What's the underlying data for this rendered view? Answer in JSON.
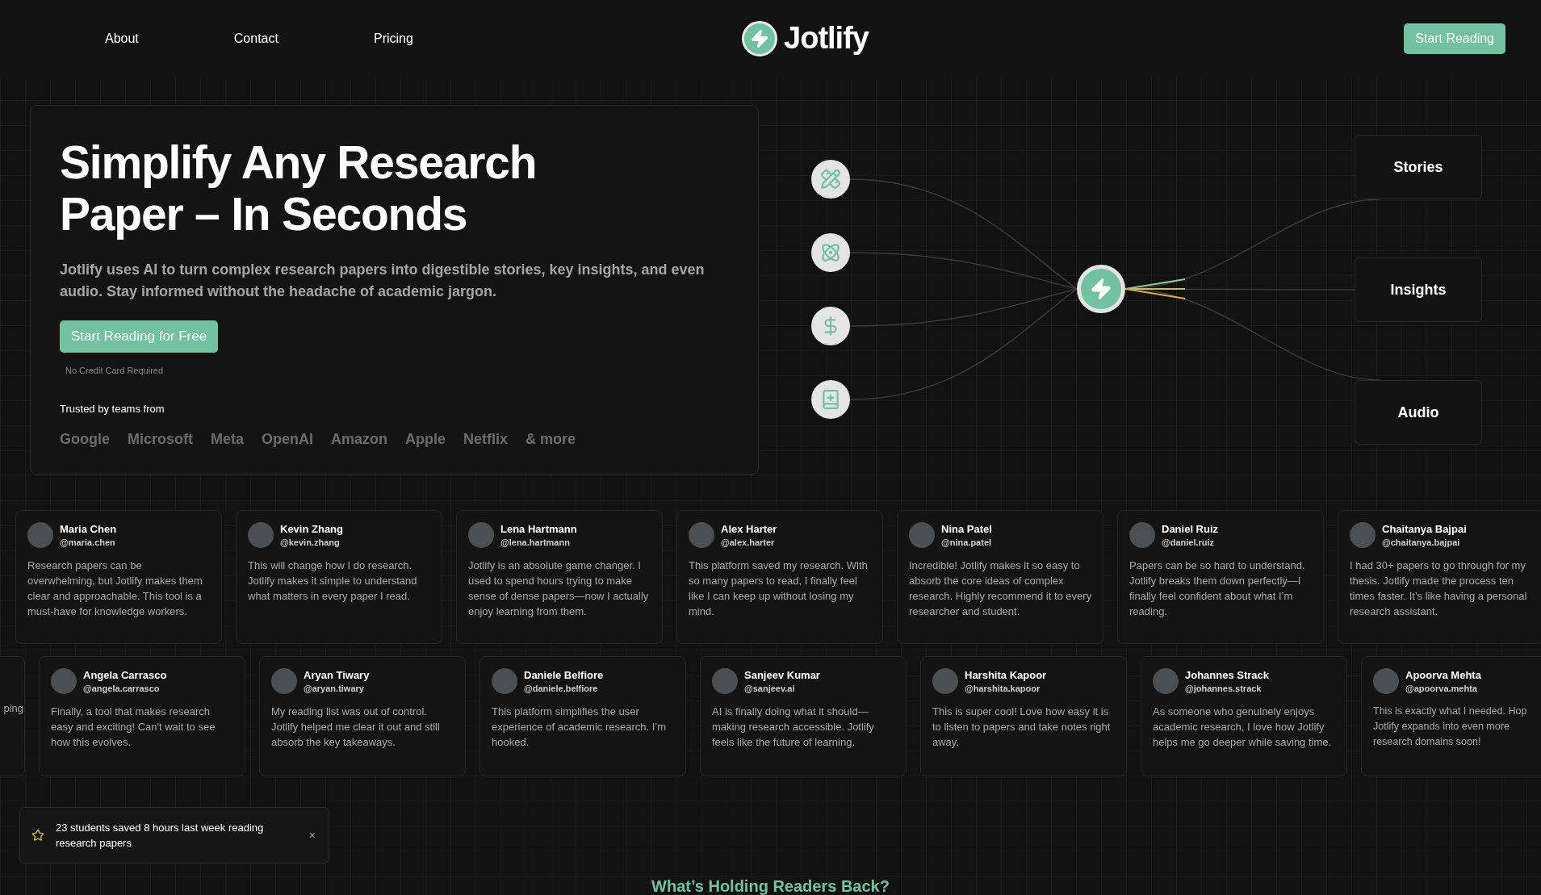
{
  "nav": {
    "links": [
      "About",
      "Contact",
      "Pricing"
    ],
    "logo": "Jotlify",
    "cta": "Start Reading"
  },
  "hero": {
    "title_lines": [
      "Simplify Any Research",
      "Paper – In Seconds"
    ],
    "subtitle": "Jotlify uses AI to turn complex research papers into digestible stories, key insights, and even audio. Stay informed without the headache of academic jargon.",
    "cta": "Start Reading for Free",
    "note": "No Credit Card Required",
    "trusted_label": "Trusted by teams from",
    "companies": [
      "Google",
      "Microsoft",
      "Meta",
      "OpenAI",
      "Amazon",
      "Apple",
      "Netflix",
      "& more"
    ]
  },
  "diagram": {
    "outputs": [
      "Stories",
      "Insights",
      "Audio"
    ]
  },
  "testimonials": [
    [
      {
        "kind": "card",
        "name": "Maria Chen",
        "handle": "@maria.chen",
        "text": "Research papers can be overwhelming, but Jotlify makes them clear and approachable. This tool is a must-have for knowledge workers."
      },
      {
        "kind": "card",
        "name": "Kevin Zhang",
        "handle": "@kevin.zhang",
        "text": "This will change how I do research. Jotlify makes it simple to understand what matters in every paper I read."
      },
      {
        "kind": "card",
        "name": "Lena Hartmann",
        "handle": "@lena.hartmann",
        "text": "Jotlify is an absolute game changer. I used to spend hours trying to make sense of dense papers—now I actually enjoy learning from them."
      },
      {
        "kind": "card",
        "name": "Alex Harter",
        "handle": "@alex.harter",
        "text": "This platform saved my research. With so many papers to read, I finally feel like I can keep up without losing my mind."
      },
      {
        "kind": "card",
        "name": "Nina Patel",
        "handle": "@nina.patel",
        "text": "Incredible! Jotlify makes it so easy to absorb the core ideas of complex research. Highly recommend it to every researcher and student."
      },
      {
        "kind": "card",
        "name": "Daniel Ruiz",
        "handle": "@daniel.ruiz",
        "text": "Papers can be so hard to understand. Jotlify breaks them down perfectly—I finally feel confident about what I’m reading."
      },
      {
        "kind": "card",
        "name": "Chaitanya Bajpai",
        "handle": "@chaitanya.bajpai",
        "text": "I had 30+ papers to go through for my thesis. Jotlify made the process ten times faster. It’s like having a personal research assistant."
      }
    ],
    [
      {
        "kind": "partial",
        "text": "ping"
      },
      {
        "kind": "card",
        "name": "Angela Carrasco",
        "handle": "@angela.carrasco",
        "text": "Finally, a tool that makes research easy and exciting! Can't wait to see how this evolves."
      },
      {
        "kind": "card",
        "name": "Aryan Tiwary",
        "handle": "@aryan.tiwary",
        "text": "My reading list was out of control. Jotlify helped me clear it out and still absorb the key takeaways."
      },
      {
        "kind": "card",
        "name": "Daniele Belfiore",
        "handle": "@daniele.belfiore",
        "text": "This platform simplifies the user experience of academic research. I’m hooked."
      },
      {
        "kind": "card",
        "name": "Sanjeev Kumar",
        "handle": "@sanjeev.ai",
        "text": "AI is finally doing what it should—making research accessible. Jotlify feels like the future of learning."
      },
      {
        "kind": "card",
        "name": "Harshita Kapoor",
        "handle": "@harshita.kapoor",
        "text": "This is super cool! Love how easy it is to listen to papers and take notes right away."
      },
      {
        "kind": "card",
        "name": "Johannes Strack",
        "handle": "@johannes.strack",
        "text": "As someone who genuinely enjoys academic research, I love how Jotlify helps me go deeper while saving time."
      },
      {
        "kind": "cut",
        "name": "Apoorva Mehta",
        "handle": "@apoorva.mehta",
        "lines": [
          "This is exactly what I needed. Hop",
          "Jotlify expands into even more",
          "research domains soon!"
        ]
      }
    ]
  ],
  "toast": {
    "message": "23 students saved 8 hours last week reading research papers",
    "close": "×"
  },
  "next_heading": "What’s Holding Readers Back?"
}
